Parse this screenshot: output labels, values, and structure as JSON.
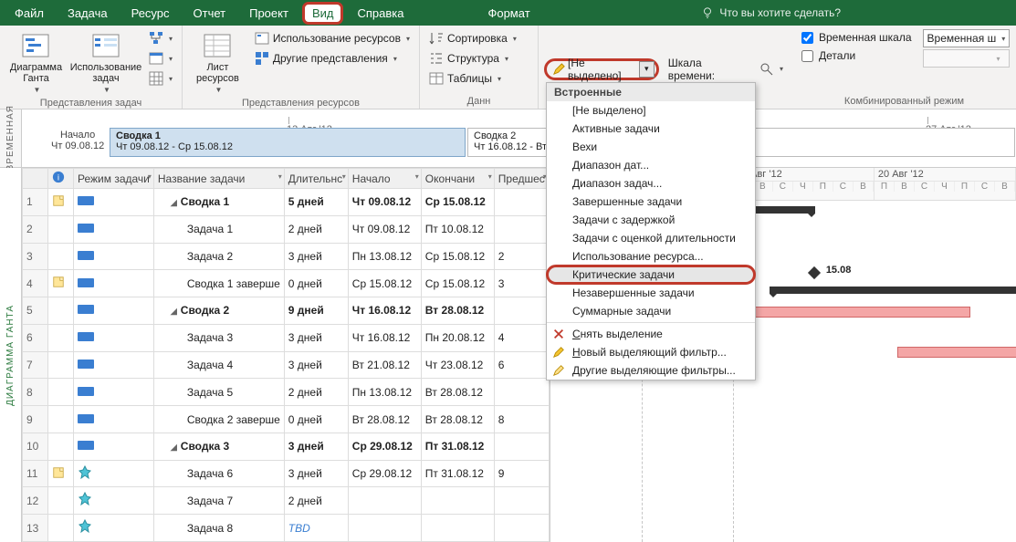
{
  "menubar": {
    "items": [
      "Файл",
      "Задача",
      "Ресурс",
      "Отчет",
      "Проект",
      "Вид",
      "Справка",
      "Формат"
    ],
    "active_index": 5,
    "tellme": "Что вы хотите сделать?"
  },
  "ribbon": {
    "group1": {
      "label": "Представления задач",
      "gantt": "Диаграмма Ганта",
      "taskuse": "Использование задач"
    },
    "group2": {
      "label": "Представления ресурсов",
      "sheet": "Лист ресурсов",
      "resuse": "Использование ресурсов",
      "other": "Другие представления"
    },
    "group3": {
      "label": "Данн",
      "sort": "Сортировка",
      "struct": "Структура",
      "tables": "Таблицы"
    },
    "group3b": {
      "highlight_value": "[Не выделено]",
      "timescale_label": "Шкала времени:"
    },
    "group5": {
      "label": "Комбинированный режим",
      "chk_timeline": "Временная шкала",
      "chk_details": "Детали",
      "combo_value": "Временная ш"
    }
  },
  "dropdown": {
    "header": "Встроенные",
    "items": [
      {
        "label": "[Не выделено]"
      },
      {
        "label": "Активные задачи"
      },
      {
        "label": "Вехи"
      },
      {
        "label": "Диапазон дат..."
      },
      {
        "label": "Диапазон задач..."
      },
      {
        "label": "Завершенные задачи"
      },
      {
        "label": "Задачи с задержкой"
      },
      {
        "label": "Задачи с оценкой длительности"
      },
      {
        "label": "Использование ресурса..."
      },
      {
        "label": "Критические задачи",
        "highlight": true
      },
      {
        "label": "Незавершенные задачи"
      },
      {
        "label": "Суммарные задачи"
      }
    ],
    "actions": [
      {
        "label": "Снять выделение",
        "icon": "clear"
      },
      {
        "label": "Новый выделяющий фильтр...",
        "icon": "pencil"
      },
      {
        "label": "Другие выделяющие фильтры...",
        "icon": "marker"
      }
    ]
  },
  "timeline": {
    "side": "ВРЕМЕННАЯ",
    "start_label": "Начало",
    "start_date": "Чт 09.08.12",
    "tick1": "13 Авг '12",
    "tick2": "27 Авг '12",
    "bar1_title": "Сводка 1",
    "bar1_range": "Чт 09.08.12 - Ср 15.08.12",
    "bar2_title": "Сводка 2",
    "bar2_range": "Чт 16.08.12 - Вт 28.08.12"
  },
  "grid": {
    "side": "ДИАГРАММА ГАНТА",
    "headers": {
      "info": "",
      "mode": "Режим задачи",
      "name": "Название задачи",
      "dur": "Длительнс",
      "start": "Начало",
      "finish": "Окончани",
      "pred": "Предшес"
    },
    "rows": [
      {
        "n": 1,
        "info": "note",
        "mode": "auto",
        "name": "Сводка 1",
        "indent": 1,
        "summary": true,
        "dur": "5 дней",
        "start": "Чт 09.08.12",
        "finish": "Ср 15.08.12",
        "pred": ""
      },
      {
        "n": 2,
        "mode": "auto",
        "name": "Задача 1",
        "indent": 2,
        "dur": "2 дней",
        "start": "Чт 09.08.12",
        "finish": "Пт 10.08.12",
        "pred": ""
      },
      {
        "n": 3,
        "mode": "auto",
        "name": "Задача 2",
        "indent": 2,
        "dur": "3 дней",
        "start": "Пн 13.08.12",
        "finish": "Ср 15.08.12",
        "pred": "2"
      },
      {
        "n": 4,
        "info": "note",
        "mode": "auto",
        "name": "Сводка 1 заверше",
        "indent": 2,
        "dur": "0 дней",
        "start": "Ср 15.08.12",
        "finish": "Ср 15.08.12",
        "pred": "3"
      },
      {
        "n": 5,
        "mode": "auto",
        "name": "Сводка 2",
        "indent": 1,
        "summary": true,
        "dur": "9 дней",
        "start": "Чт 16.08.12",
        "finish": "Вт 28.08.12",
        "pred": ""
      },
      {
        "n": 6,
        "mode": "auto",
        "name": "Задача 3",
        "indent": 2,
        "dur": "3 дней",
        "start": "Чт 16.08.12",
        "finish": "Пн 20.08.12",
        "pred": "4"
      },
      {
        "n": 7,
        "mode": "auto",
        "name": "Задача 4",
        "indent": 2,
        "dur": "3 дней",
        "start": "Вт 21.08.12",
        "finish": "Чт 23.08.12",
        "pred": "6"
      },
      {
        "n": 8,
        "mode": "auto",
        "name": "Задача 5",
        "indent": 2,
        "dur": "2 дней",
        "start": "Пн 13.08.12",
        "finish": "Вт 28.08.12",
        "pred": ""
      },
      {
        "n": 9,
        "mode": "auto",
        "name": "Сводка 2 заверше",
        "indent": 2,
        "dur": "0 дней",
        "start": "Вт 28.08.12",
        "finish": "Вт 28.08.12",
        "pred": "8"
      },
      {
        "n": 10,
        "mode": "auto",
        "name": "Сводка 3",
        "indent": 1,
        "summary": true,
        "dur": "3 дней",
        "start": "Ср 29.08.12",
        "finish": "Пт 31.08.12",
        "pred": ""
      },
      {
        "n": 11,
        "info": "note",
        "mode": "pin",
        "name": "Задача 6",
        "indent": 2,
        "dur": "3 дней",
        "start": "Ср 29.08.12",
        "finish": "Пт 31.08.12",
        "pred": "9"
      },
      {
        "n": 12,
        "mode": "pin",
        "name": "Задача 7",
        "indent": 2,
        "dur": "2 дней",
        "start": "",
        "finish": "",
        "pred": ""
      },
      {
        "n": 13,
        "mode": "pin",
        "name": "Задача 8",
        "indent": 2,
        "dur": "TBD",
        "tbd": true,
        "start": "",
        "finish": "",
        "pred": ""
      }
    ]
  },
  "gantt": {
    "weeks": [
      "13 Авг '12",
      "20 Авг '12"
    ],
    "days": [
      "П",
      "В",
      "С",
      "Ч",
      "П",
      "С",
      "В"
    ],
    "milestone_label": "15.08"
  }
}
